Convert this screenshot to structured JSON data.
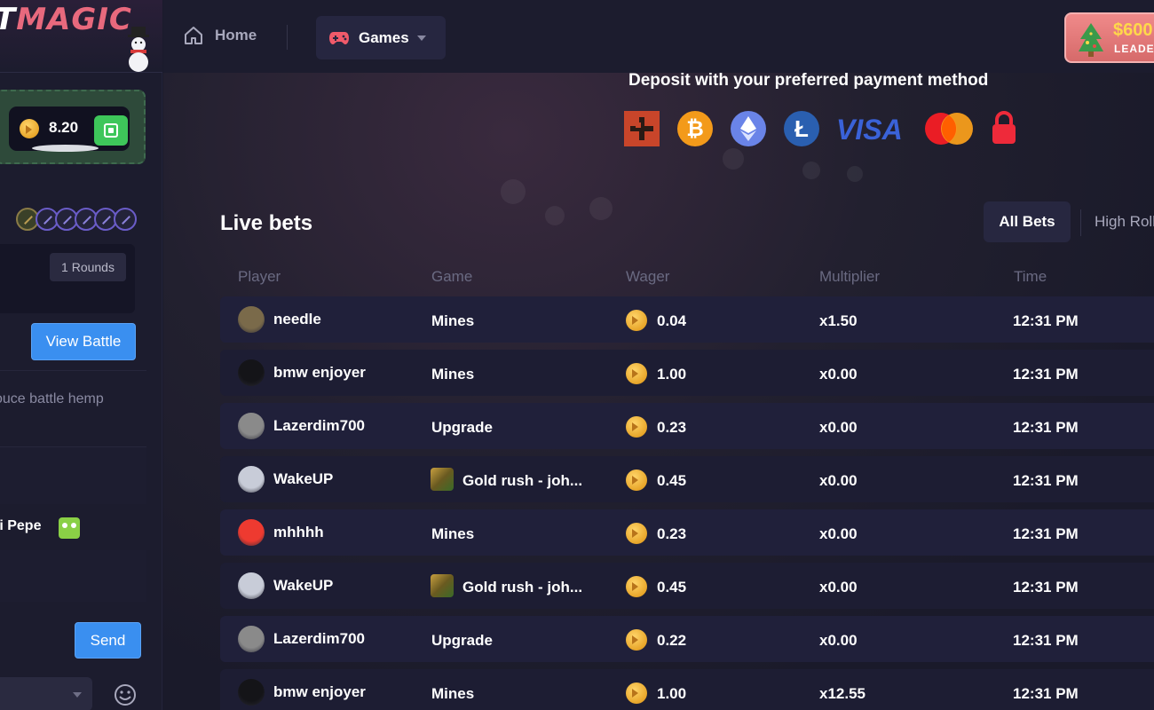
{
  "logo": {
    "text_left": "T",
    "text_right": "MAGIC"
  },
  "sidebar": {
    "balance": "8.20",
    "battle": {
      "rounds": "1 Rounds",
      "view_button": "View Battle"
    },
    "chat": [
      {
        "text": "ouce battle hemp"
      },
      {
        "name": "ti Pepe"
      }
    ],
    "send_button": "Send"
  },
  "topbar": {
    "nav": {
      "home": "Home",
      "games": "Games"
    },
    "leaderboard": {
      "amount": "$600",
      "label": "LEADERBOARD"
    }
  },
  "deposit": {
    "title": "Deposit with your preferred payment method",
    "methods": [
      "rust-icon",
      "bitcoin-icon",
      "ethereum-icon",
      "litecoin-icon",
      "visa-icon",
      "mastercard-icon",
      "lock-icon"
    ],
    "visa_text": "VISA"
  },
  "live_bets": {
    "title": "Live bets",
    "tabs": {
      "all": "All Bets",
      "high": "High Rollers"
    },
    "columns": {
      "player": "Player",
      "game": "Game",
      "wager": "Wager",
      "multiplier": "Multiplier",
      "time": "Time"
    },
    "rows": [
      {
        "player": "needle",
        "game": "Mines",
        "game_icon": false,
        "wager": "0.04",
        "multiplier": "x1.50",
        "time": "12:31 PM",
        "avatar": "#7a6a4a"
      },
      {
        "player": "bmw enjoyer",
        "game": "Mines",
        "game_icon": false,
        "wager": "1.00",
        "multiplier": "x0.00",
        "time": "12:31 PM",
        "avatar": "#141418"
      },
      {
        "player": "Lazerdim700",
        "game": "Upgrade",
        "game_icon": false,
        "wager": "0.23",
        "multiplier": "x0.00",
        "time": "12:31 PM",
        "avatar": "#8a8a8a"
      },
      {
        "player": "WakeUP",
        "game": "Gold rush - joh...",
        "game_icon": true,
        "wager": "0.45",
        "multiplier": "x0.00",
        "time": "12:31 PM",
        "avatar": "#c8ccd8"
      },
      {
        "player": "mhhhh",
        "game": "Mines",
        "game_icon": false,
        "wager": "0.23",
        "multiplier": "x0.00",
        "time": "12:31 PM",
        "avatar": "#ee3a30"
      },
      {
        "player": "WakeUP",
        "game": "Gold rush - joh...",
        "game_icon": true,
        "wager": "0.45",
        "multiplier": "x0.00",
        "time": "12:31 PM",
        "avatar": "#c8ccd8"
      },
      {
        "player": "Lazerdim700",
        "game": "Upgrade",
        "game_icon": false,
        "wager": "0.22",
        "multiplier": "x0.00",
        "time": "12:31 PM",
        "avatar": "#8a8a8a"
      },
      {
        "player": "bmw enjoyer",
        "game": "Mines",
        "game_icon": false,
        "wager": "1.00",
        "multiplier": "x12.55",
        "time": "12:31 PM",
        "avatar": "#141418"
      }
    ]
  },
  "colors": {
    "accent_blue": "#3a8ff0",
    "green": "#3ec65a",
    "leader_red": "#d66a6a",
    "coin_gold": "#e8a62a"
  }
}
